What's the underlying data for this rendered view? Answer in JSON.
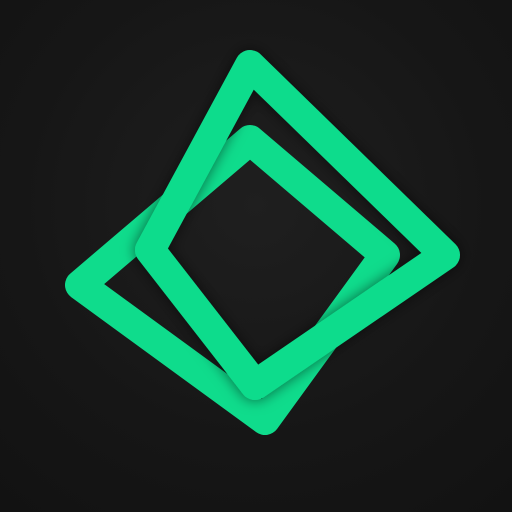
{
  "logo": {
    "name": "overlapping-rounded-squares-logo",
    "colors": {
      "background": "#151515",
      "accent": "#0fdc8c",
      "accent_shadow": "#06b06c"
    }
  }
}
